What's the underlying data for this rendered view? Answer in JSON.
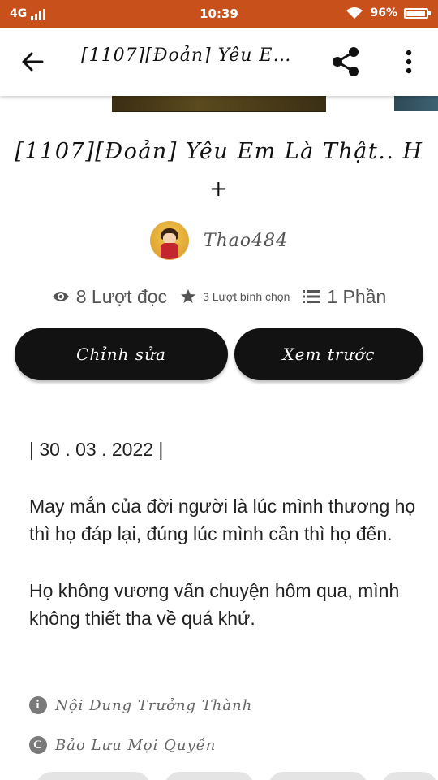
{
  "status_bar": {
    "network": "4G",
    "time": "10:39",
    "battery": "96%",
    "battery_level": 0.96
  },
  "app_bar": {
    "title": "[1107][Đoản] Yêu Em ...",
    "back_icon": "arrow-left-icon",
    "share_icon": "share-icon",
    "more_icon": "more-vertical-icon"
  },
  "story": {
    "title": "[1107][Đoản] Yêu Em Là Thật.. H +",
    "author": "Thao484",
    "stats": {
      "reads": "8 Lượt đọc",
      "votes": "3 Lượt bình chọn",
      "parts": "1 Phần"
    },
    "buttons": {
      "edit": "Chỉnh sửa",
      "preview": "Xem trước"
    },
    "content": {
      "date": "| 30 . 03 . 2022 |",
      "paragraph1": "May mắn của đời người là lúc mình thương họ thì họ đáp lại, đúng lúc mình cần thì họ đến.",
      "paragraph2": "Họ không vương vấn chuyện hôm qua, mình không thiết tha về quá khứ."
    },
    "info": {
      "maturity": "Nội Dung Trưởng Thành",
      "copyright": "Bảo Lưu Mọi Quyền",
      "maturity_icon": "i",
      "copyright_icon": "C"
    }
  },
  "colors": {
    "status_bar": "#c7501b",
    "button_bg": "#121212"
  }
}
